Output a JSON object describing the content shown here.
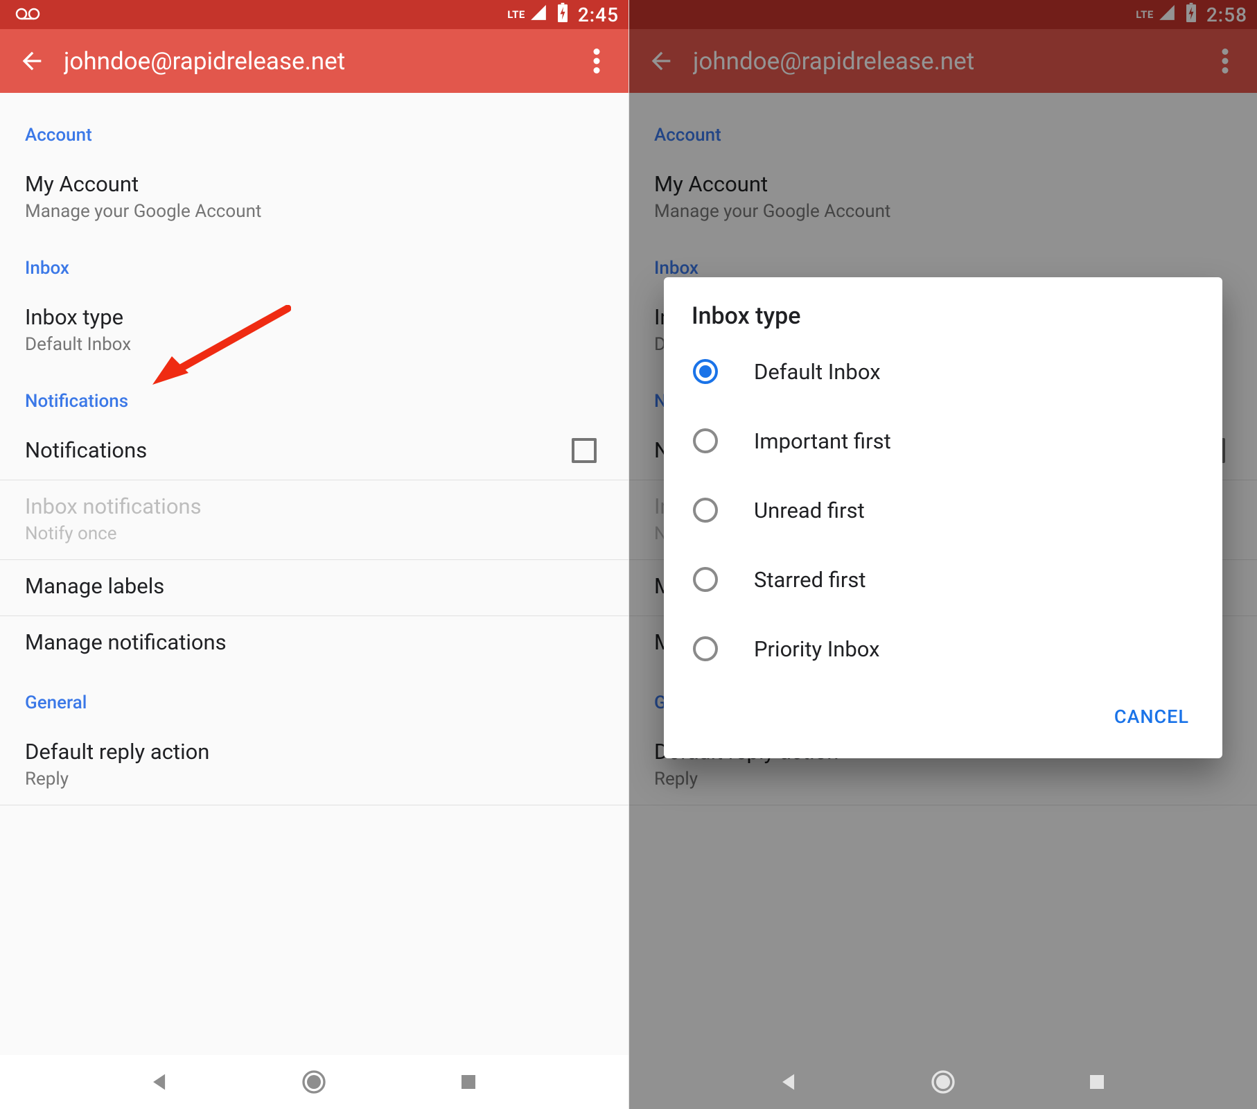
{
  "left": {
    "status": {
      "time": "2:45",
      "lte": "LTE"
    },
    "appbar": {
      "title": "johndoe@rapidrelease.net"
    },
    "sections": {
      "account": {
        "header": "Account",
        "my_account": {
          "title": "My Account",
          "subtitle": "Manage your Google Account"
        }
      },
      "inbox": {
        "header": "Inbox",
        "inbox_type": {
          "title": "Inbox type",
          "subtitle": "Default Inbox"
        }
      },
      "notifications": {
        "header": "Notifications",
        "notifications": {
          "title": "Notifications"
        },
        "inbox_notifications": {
          "title": "Inbox notifications",
          "subtitle": "Notify once"
        },
        "manage_labels": {
          "title": "Manage labels"
        },
        "manage_notifications": {
          "title": "Manage notifications"
        }
      },
      "general": {
        "header": "General",
        "default_reply": {
          "title": "Default reply action",
          "subtitle": "Reply"
        }
      }
    }
  },
  "right": {
    "status": {
      "time": "2:58",
      "lte": "LTE"
    },
    "appbar": {
      "title": "johndoe@rapidrelease.net"
    },
    "dialog": {
      "title": "Inbox type",
      "options": {
        "o0": "Default Inbox",
        "o1": "Important first",
        "o2": "Unread first",
        "o3": "Starred first",
        "o4": "Priority Inbox"
      },
      "selected_index": 0,
      "cancel": "CANCEL"
    }
  }
}
